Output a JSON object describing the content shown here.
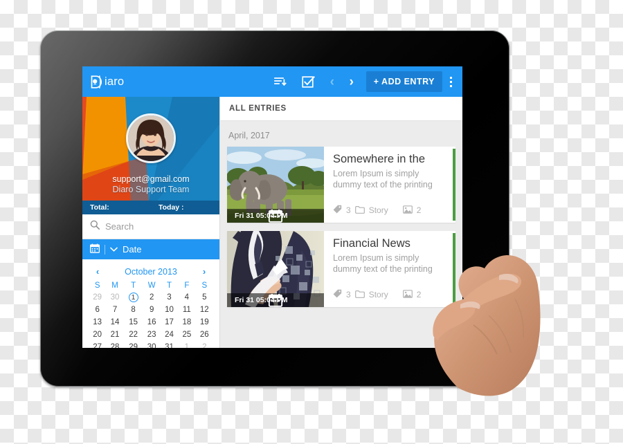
{
  "app": {
    "logo_text": "iaro",
    "logo_icon": "diaro-logo-icon"
  },
  "toolbar": {
    "sort_icon": "sort-descending-icon",
    "select_icon": "checkbox-checked-icon",
    "prev_label": "‹",
    "next_label": "›",
    "add_entry_label": "+ ADD ENTRY",
    "overflow_icon": "more-vertical-icon"
  },
  "sidebar": {
    "profile": {
      "email": "support@gmail.com",
      "name": "Diaro Support Team",
      "avatar_icon": "user-avatar"
    },
    "stats": {
      "total_label": "Total:",
      "total_value": "",
      "today_label": "Today :",
      "today_value": ""
    },
    "search": {
      "icon": "search-icon",
      "placeholder": "Search",
      "value": ""
    },
    "date_filter": {
      "icon": "calendar-icon",
      "chevron_icon": "chevron-down-icon",
      "label": "Date"
    },
    "calendar": {
      "prev_icon": "chevron-left-icon",
      "next_icon": "chevron-right-icon",
      "title": "October 2013",
      "weekdays": [
        "S",
        "M",
        "T",
        "W",
        "T",
        "F",
        "S"
      ],
      "weeks": [
        [
          {
            "d": "29",
            "muted": true
          },
          {
            "d": "30",
            "muted": true
          },
          {
            "d": "1",
            "today": true
          },
          {
            "d": "2"
          },
          {
            "d": "3"
          },
          {
            "d": "4"
          },
          {
            "d": "5"
          }
        ],
        [
          {
            "d": "6"
          },
          {
            "d": "7"
          },
          {
            "d": "8"
          },
          {
            "d": "9"
          },
          {
            "d": "10"
          },
          {
            "d": "11"
          },
          {
            "d": "12"
          }
        ],
        [
          {
            "d": "13"
          },
          {
            "d": "14"
          },
          {
            "d": "15"
          },
          {
            "d": "16"
          },
          {
            "d": "17"
          },
          {
            "d": "18"
          },
          {
            "d": "19"
          }
        ],
        [
          {
            "d": "20"
          },
          {
            "d": "21"
          },
          {
            "d": "22"
          },
          {
            "d": "23"
          },
          {
            "d": "24"
          },
          {
            "d": "25"
          },
          {
            "d": "26"
          }
        ],
        [
          {
            "d": "27"
          },
          {
            "d": "28"
          },
          {
            "d": "29"
          },
          {
            "d": "30"
          },
          {
            "d": "31"
          },
          {
            "d": "1",
            "muted": true
          },
          {
            "d": "2",
            "muted": true
          }
        ]
      ]
    }
  },
  "entries_panel": {
    "header_title": "ALL ENTRIES",
    "month_label": "April, 2017",
    "entries": [
      {
        "title": "Somewhere in the",
        "excerpt": "Lorem Ipsum is simply dummy text of the printing",
        "date": "Fri 31  05:04 PM",
        "date_icon": "calendar-icon",
        "tag_icon": "tag-icon",
        "tag_count": "3",
        "folder_icon": "folder-icon",
        "folder_name": "Story",
        "photo_icon": "image-icon",
        "photo_count": "2",
        "thumb": "elephant-photo",
        "accent_color": "#4c9e43"
      },
      {
        "title": "Financial News",
        "excerpt": "Lorem Ipsum is simply dummy text of the printing",
        "date": "Fri 31  05:04 PM",
        "date_icon": "calendar-icon",
        "tag_icon": "tag-icon",
        "tag_count": "3",
        "folder_icon": "folder-icon",
        "folder_name": "Story",
        "photo_icon": "image-icon",
        "photo_count": "2",
        "thumb": "businessman-photo",
        "accent_color": "#4c9e43"
      }
    ]
  },
  "colors": {
    "brand_blue": "#2196f3",
    "brand_blue_dark": "#1a7fd4",
    "stats_blue": "#0f5d94",
    "accent_green": "#4c9e43",
    "panel_grey": "#ececec"
  },
  "device": {
    "type": "tablet",
    "hand_overlay": "hand-pinch-gesture"
  }
}
